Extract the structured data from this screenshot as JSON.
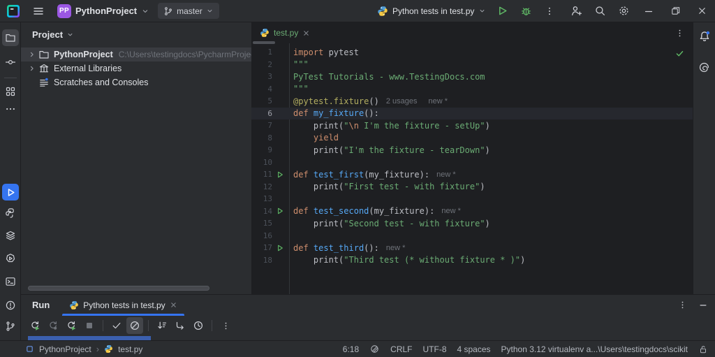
{
  "colors": {
    "accent": "#3574F0",
    "bg_dark": "#1E1F22",
    "bg_panel": "#2B2D30",
    "selection": "#393B40",
    "keyword": "#CF8E6D",
    "string": "#6AAB73",
    "function": "#56A8F5",
    "decorator": "#B3AE60",
    "run_green": "#5FB865",
    "tab_added_file": "#6AAB73"
  },
  "titlebar": {
    "project_badge": "PP",
    "project_name": "PythonProject",
    "branch_name": "master",
    "run_config": "Python tests in test.py"
  },
  "left_sidebar": {
    "top": [
      {
        "name": "project",
        "active": true
      },
      {
        "name": "commit"
      },
      {
        "name": "structure"
      },
      {
        "name": "more"
      }
    ],
    "bottom": [
      {
        "name": "run",
        "active": true
      },
      {
        "name": "python-console"
      },
      {
        "name": "services"
      },
      {
        "name": "run-anything"
      },
      {
        "name": "terminal"
      },
      {
        "name": "problems"
      },
      {
        "name": "version-control"
      }
    ]
  },
  "project_panel": {
    "title": "Project",
    "items": [
      {
        "label": "PythonProject",
        "path": "C:\\Users\\testingdocs\\PycharmProjects\\Py",
        "icon": "folder",
        "chevron": true,
        "selected": true
      },
      {
        "label": "External Libraries",
        "icon": "library",
        "chevron": true,
        "selected": false
      },
      {
        "label": "Scratches and Consoles",
        "icon": "scratches",
        "chevron": false,
        "selected": false
      }
    ]
  },
  "editor": {
    "tab": {
      "label": "test.py",
      "modified_state": "added"
    },
    "inspection_status": "no-problems",
    "lines": [
      {
        "n": 1,
        "tokens": [
          [
            "kw",
            "import"
          ],
          [
            "pl",
            " pytest"
          ]
        ]
      },
      {
        "n": 2,
        "tokens": [
          [
            "str",
            "\"\"\""
          ]
        ]
      },
      {
        "n": 3,
        "tokens": [
          [
            "str",
            "PyTest Tutorials - www.TestingDocs.com"
          ]
        ]
      },
      {
        "n": 4,
        "tokens": [
          [
            "str",
            "\"\"\""
          ]
        ]
      },
      {
        "n": 5,
        "tokens": [
          [
            "deco",
            "@pytest.fixture"
          ],
          [
            "pl",
            "()"
          ]
        ],
        "inlays": [
          "2 usages",
          "new *"
        ]
      },
      {
        "n": 6,
        "tokens": [
          [
            "kw",
            "def"
          ],
          [
            "pl",
            " "
          ],
          [
            "fn",
            "my_fixture"
          ],
          [
            "pl",
            "():"
          ]
        ],
        "current": true
      },
      {
        "n": 7,
        "tokens": [
          [
            "pl",
            "    print("
          ],
          [
            "str",
            "\""
          ],
          [
            "esc",
            "\\n"
          ],
          [
            "str",
            " I'm the fixture - setUp\""
          ],
          [
            "pl",
            ")"
          ]
        ]
      },
      {
        "n": 8,
        "tokens": [
          [
            "pl",
            "    "
          ],
          [
            "kw",
            "yield"
          ]
        ]
      },
      {
        "n": 9,
        "tokens": [
          [
            "pl",
            "    print("
          ],
          [
            "str",
            "\"I'm the fixture - tearDown\""
          ],
          [
            "pl",
            ")"
          ]
        ]
      },
      {
        "n": 10,
        "tokens": []
      },
      {
        "n": 11,
        "tokens": [
          [
            "kw",
            "def"
          ],
          [
            "pl",
            " "
          ],
          [
            "fn",
            "test_first"
          ],
          [
            "pl",
            "(my_fixture):"
          ]
        ],
        "run": true,
        "inlays": [
          "new *"
        ]
      },
      {
        "n": 12,
        "tokens": [
          [
            "pl",
            "    print("
          ],
          [
            "str",
            "\"First test - with fixture\""
          ],
          [
            "pl",
            ")"
          ]
        ]
      },
      {
        "n": 13,
        "tokens": []
      },
      {
        "n": 14,
        "tokens": [
          [
            "kw",
            "def"
          ],
          [
            "pl",
            " "
          ],
          [
            "fn",
            "test_second"
          ],
          [
            "pl",
            "(my_fixture):"
          ]
        ],
        "run": true,
        "inlays": [
          "new *"
        ]
      },
      {
        "n": 15,
        "tokens": [
          [
            "pl",
            "    print("
          ],
          [
            "str",
            "\"Second test - with fixture\""
          ],
          [
            "pl",
            ")"
          ]
        ]
      },
      {
        "n": 16,
        "tokens": []
      },
      {
        "n": 17,
        "tokens": [
          [
            "kw",
            "def"
          ],
          [
            "pl",
            " "
          ],
          [
            "fn",
            "test_third"
          ],
          [
            "pl",
            "():"
          ]
        ],
        "run": true,
        "inlays": [
          "new *"
        ]
      },
      {
        "n": 18,
        "tokens": [
          [
            "pl",
            "    print("
          ],
          [
            "str",
            "\"Third test (* without fixture * )\""
          ],
          [
            "pl",
            ")"
          ]
        ]
      }
    ]
  },
  "run_panel": {
    "title": "Run",
    "tab": {
      "label": "Python tests in test.py"
    },
    "toolbar": [
      "rerun",
      "rerun-failed",
      "rerun-auto",
      "stop",
      "sep",
      "show-passed",
      "show-ignored",
      "sep",
      "sort-by-duration",
      "navigate",
      "show-duration",
      "sep",
      "more"
    ],
    "active_toggle": "show-ignored"
  },
  "status_bar": {
    "breadcrumb": {
      "project": "PythonProject",
      "file": "test.py"
    },
    "cursor_position": "6:18",
    "line_ending": "CRLF",
    "encoding": "UTF-8",
    "indent": "4 spaces",
    "interpreter": "Python 3.12 virtualenv a...\\Users\\testingdocs\\scikit"
  }
}
